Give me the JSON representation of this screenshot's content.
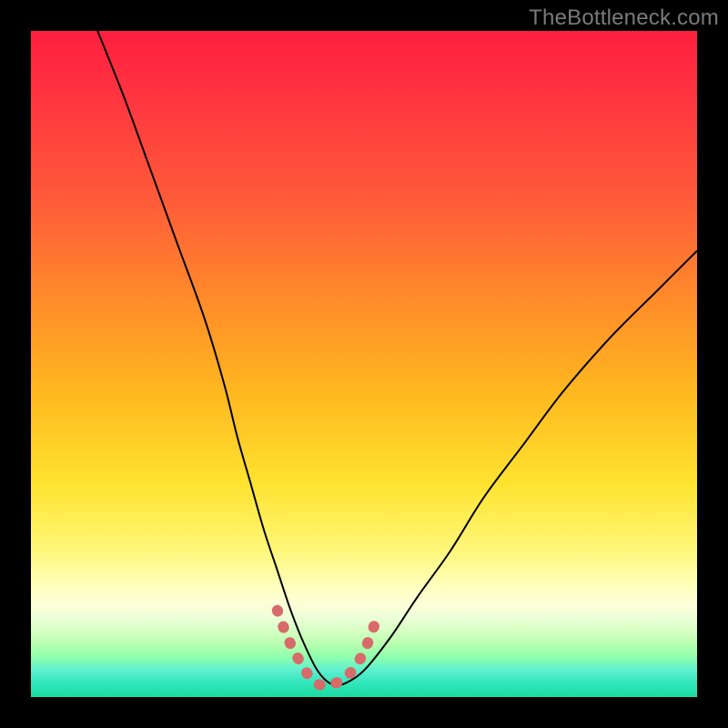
{
  "watermark": "TheBottleneck.com",
  "chart_data": {
    "type": "line",
    "title": "",
    "xlabel": "",
    "ylabel": "",
    "xlim": [
      0,
      100
    ],
    "ylim": [
      0,
      100
    ],
    "background_gradient": {
      "orientation": "vertical",
      "stops": [
        {
          "pos": 0,
          "color": "#ff1f3f"
        },
        {
          "pos": 25,
          "color": "#ff5a3a"
        },
        {
          "pos": 54,
          "color": "#ffb71f"
        },
        {
          "pos": 78,
          "color": "#fff77a"
        },
        {
          "pos": 90,
          "color": "#d7ffc4"
        },
        {
          "pos": 100,
          "color": "#19dca0"
        }
      ]
    },
    "series": [
      {
        "name": "bottleneck-curve",
        "stroke": "#000000",
        "stroke_width": 2,
        "x": [
          10,
          14,
          18,
          22,
          26,
          29,
          31,
          33,
          35,
          37,
          39,
          41,
          43,
          45,
          47,
          50,
          54,
          58,
          63,
          68,
          74,
          80,
          87,
          94,
          100
        ],
        "y": [
          100,
          90,
          79,
          68,
          57,
          47,
          39,
          32,
          25,
          19,
          13,
          8,
          4,
          2,
          2,
          4,
          9,
          15,
          22,
          30,
          38,
          46,
          54,
          61,
          67
        ]
      },
      {
        "name": "highlight-bottom",
        "stroke": "#d86a6a",
        "stroke_width": 10,
        "linecap": "round",
        "x": [
          37,
          38.5,
          40,
          41.5,
          43,
          44.5,
          46,
          47.5,
          49,
          50.5,
          52
        ],
        "y": [
          13,
          9,
          6,
          3.5,
          2,
          1.8,
          2.2,
          3.2,
          5,
          8,
          12
        ]
      }
    ]
  }
}
